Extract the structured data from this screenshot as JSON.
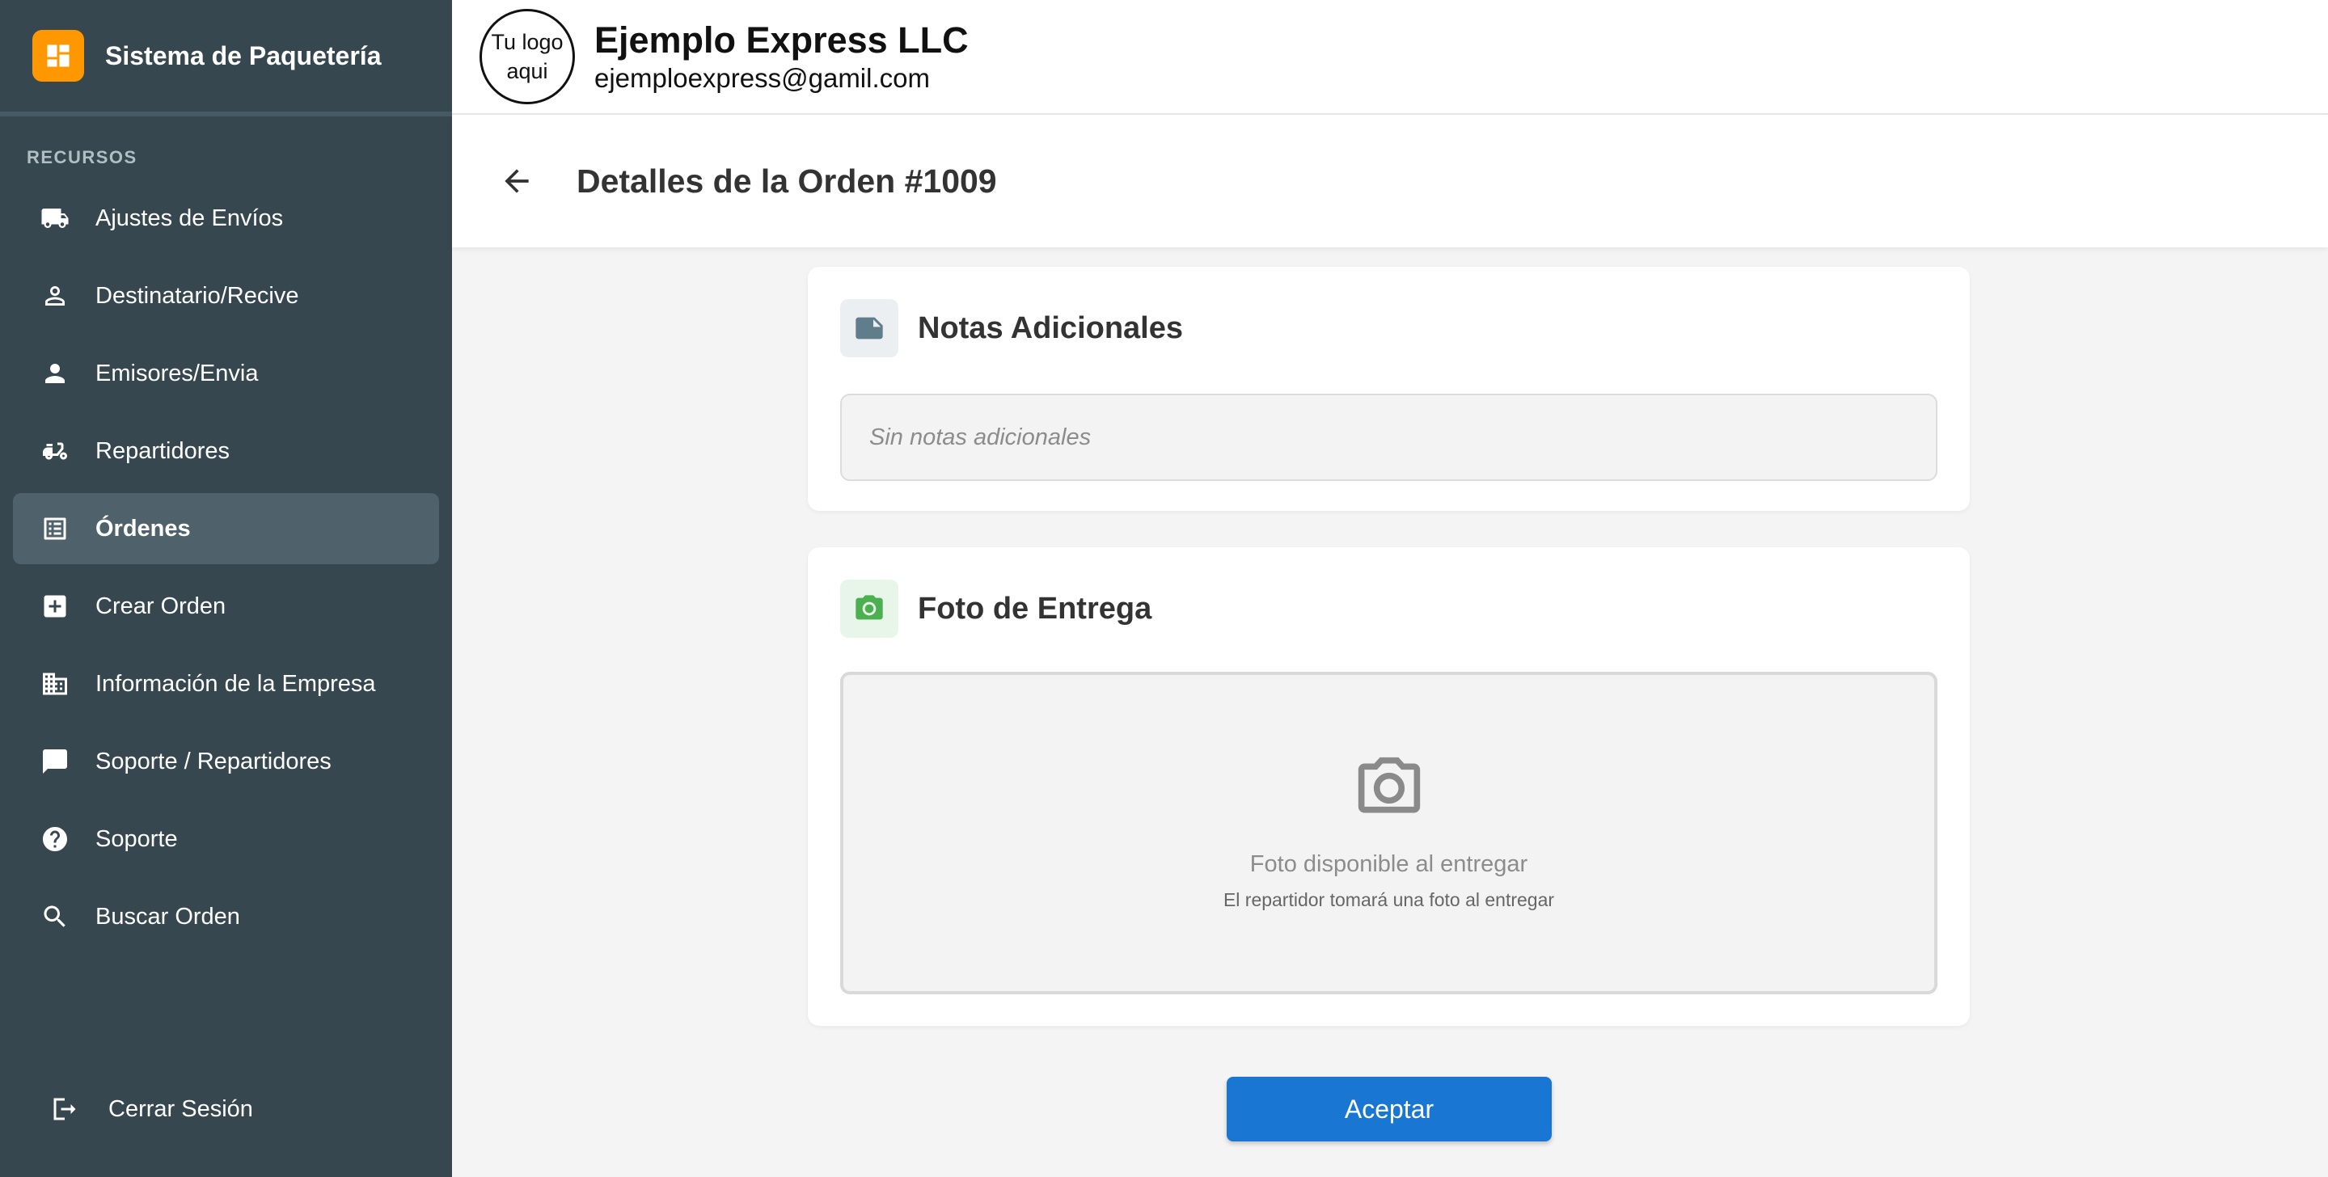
{
  "app": {
    "title": "Sistema de Paquetería"
  },
  "sidebar": {
    "section_label": "RECURSOS",
    "items": [
      {
        "label": "Ajustes de Envíos",
        "icon": "truck-icon"
      },
      {
        "label": "Destinatario/Recive",
        "icon": "person-outline-icon"
      },
      {
        "label": "Emisores/Envia",
        "icon": "person-icon"
      },
      {
        "label": "Repartidores",
        "icon": "delivery-scooter-icon"
      },
      {
        "label": "Órdenes",
        "icon": "list-icon",
        "active": true
      },
      {
        "label": "Crear Orden",
        "icon": "add-box-icon"
      },
      {
        "label": "Información de la Empresa",
        "icon": "building-icon"
      },
      {
        "label": "Soporte / Repartidores",
        "icon": "chat-icon"
      },
      {
        "label": "Soporte",
        "icon": "help-icon"
      },
      {
        "label": "Buscar Orden",
        "icon": "search-icon"
      }
    ],
    "logout_label": "Cerrar Sesión"
  },
  "header": {
    "logo_line1": "Tu logo",
    "logo_line2": "aqui",
    "company_name": "Ejemplo Express LLC",
    "company_email": "ejemploexpress@gamil.com"
  },
  "page": {
    "title": "Detalles de la Orden #1009"
  },
  "notes": {
    "title": "Notas Adicionales",
    "placeholder": "Sin notas adicionales"
  },
  "photo": {
    "title": "Foto de Entrega",
    "status": "Foto disponible al entregar",
    "hint": "El repartidor tomará una foto al entregar"
  },
  "actions": {
    "accept_label": "Aceptar"
  },
  "colors": {
    "sidebar_bg": "#37474f",
    "brand_accent": "#ff9800",
    "primary_button": "#1976d2",
    "photo_icon_green": "#4caf50",
    "notes_icon_gray": "#607d8b"
  }
}
